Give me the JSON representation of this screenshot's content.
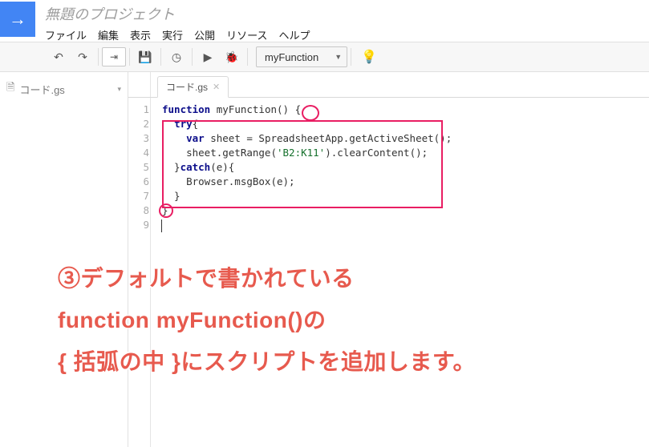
{
  "header": {
    "project_title": "無題のプロジェクト",
    "menus": [
      "ファイル",
      "編集",
      "表示",
      "実行",
      "公開",
      "リソース",
      "ヘルプ"
    ]
  },
  "toolbar": {
    "function_selected": "myFunction"
  },
  "sidebar": {
    "file_name": "コード.gs"
  },
  "editor": {
    "tab_label": "コード.gs",
    "lines": {
      "l1a": "function",
      "l1b": " myFunction() {",
      "l2a": "  ",
      "l2b": "try",
      "l2c": "{",
      "l3a": "    ",
      "l3b": "var",
      "l3c": " sheet = SpreadsheetApp.getActiveSheet();",
      "l4a": "    sheet.getRange(",
      "l4b": "'B2:K11'",
      "l4c": ").clearContent();",
      "l5": "  }",
      "l5b": "catch",
      "l5c": "(e){",
      "l6": "    Browser.msgBox(e);",
      "l7": "  }",
      "l8": "}",
      "l9": ""
    },
    "line_numbers": [
      "1",
      "2",
      "3",
      "4",
      "5",
      "6",
      "7",
      "8",
      "9"
    ]
  },
  "annotation": {
    "line1": "③デフォルトで書かれている",
    "line2": "function myFunction()の",
    "line3": "{ 括弧の中 }にスクリプトを追加します。"
  }
}
